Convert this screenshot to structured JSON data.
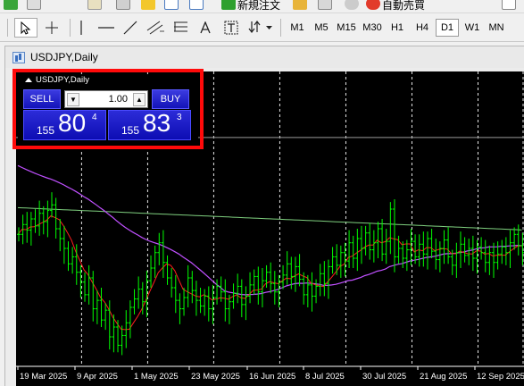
{
  "toolbar": {
    "new_order_label": "新規注文",
    "auto_trading_label": "自動売買",
    "timeframes": [
      "M1",
      "M5",
      "M15",
      "M30",
      "H1",
      "H4",
      "D1",
      "W1",
      "MN"
    ],
    "active_timeframe": "D1"
  },
  "window": {
    "title": "USDJPY,Daily"
  },
  "one_click": {
    "symbol_title": "USDJPY,Daily",
    "sell_label": "SELL",
    "buy_label": "BUY",
    "lot_value": "1.00",
    "sell_price": {
      "prefix": "155",
      "big": "80",
      "pipette": "4"
    },
    "buy_price": {
      "prefix": "155",
      "big": "83",
      "pipette": "3"
    }
  },
  "chart_data": {
    "type": "candlestick",
    "symbol": "USDJPY",
    "timeframe": "Daily",
    "x_tick_labels": [
      "19 Mar 2025",
      "9 Apr 2025",
      "1 May 2025",
      "23 May 2025",
      "16 Jun 2025",
      "8 Jul 2025",
      "30 Jul 2025",
      "21 Aug 2025",
      "12 Sep 2025"
    ],
    "colors": {
      "background": "#000000",
      "candles": "#00ff00",
      "ma_fast": "#ff1e1e",
      "ma_mid": "#c050ff",
      "ma_slow": "#7fd07f",
      "grid": "#ffffff",
      "bid_line": "#9a9a9a"
    },
    "grid": "vertical dotted",
    "series": [
      {
        "close": [
          148.9,
          149.6,
          149.2,
          150.0,
          149.5,
          150.4,
          149.8,
          150.6,
          151.0,
          149.3,
          148.6,
          147.9,
          146.8,
          147.3,
          146.2,
          145.5,
          144.6,
          145.8,
          143.6,
          144.2,
          142.8,
          143.5,
          141.6,
          142.3,
          141.0,
          141.7,
          142.6,
          143.7,
          144.3,
          145.0,
          144.1,
          145.6,
          146.5,
          147.6,
          148.3,
          146.9,
          145.8,
          145.1,
          144.2,
          143.6,
          144.4,
          145.8,
          144.9,
          144.2,
          143.8,
          144.5,
          143.6,
          144.4,
          145.2,
          144.8,
          143.6,
          144.1,
          144.7,
          145.2,
          143.9,
          144.5,
          145.3,
          145.9,
          144.8,
          145.6,
          146.2,
          145.4,
          144.8,
          145.5,
          146.0,
          146.8,
          145.9,
          146.6,
          145.7,
          144.6,
          145.3,
          144.5,
          145.2,
          146.1,
          145.4,
          146.6,
          147.3,
          146.7,
          147.6,
          147.0,
          148.3,
          147.2,
          148.6,
          147.9,
          149.0,
          147.8,
          148.3,
          149.3,
          147.5,
          148.4,
          150.7,
          147.3,
          147.9,
          147.2,
          147.8,
          148.4,
          147.3,
          148.2,
          147.5,
          148.6,
          147.7,
          147.1,
          147.9,
          148.5,
          147.3,
          146.7,
          147.6,
          148.2,
          147.4,
          147.9,
          147.2,
          148.0,
          147.6,
          146.9,
          147.6,
          146.9,
          147.5,
          148.0,
          147.6,
          148.3,
          148.9,
          148.1,
          147.6
        ]
      },
      {
        "name": "",
        "ma_fast": []
      },
      {
        "name": "",
        "ma_mid": []
      }
    ]
  }
}
